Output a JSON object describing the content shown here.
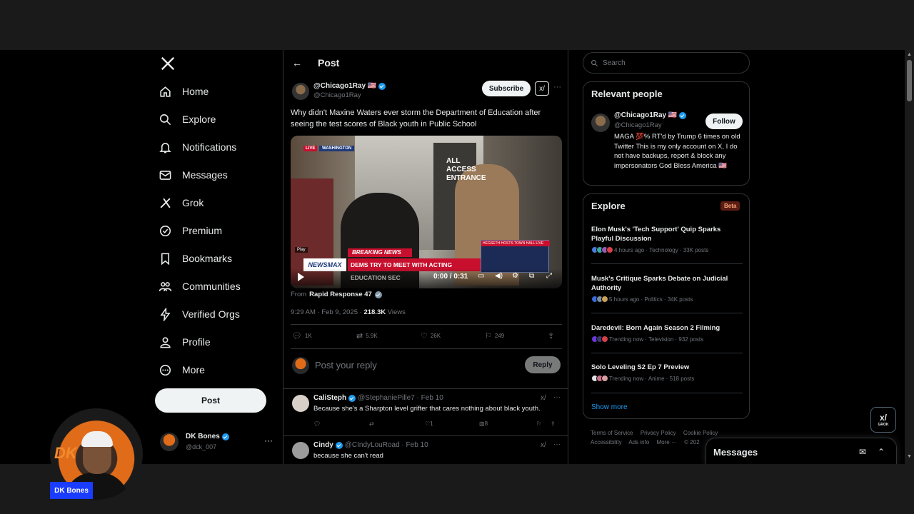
{
  "sidebar": {
    "nav": [
      {
        "label": "Home",
        "icon": "home-icon"
      },
      {
        "label": "Explore",
        "icon": "search-icon"
      },
      {
        "label": "Notifications",
        "icon": "bell-icon"
      },
      {
        "label": "Messages",
        "icon": "mail-icon"
      },
      {
        "label": "Grok",
        "icon": "grok-icon"
      },
      {
        "label": "Premium",
        "icon": "premium-icon"
      },
      {
        "label": "Bookmarks",
        "icon": "bookmark-icon"
      },
      {
        "label": "Communities",
        "icon": "communities-icon"
      },
      {
        "label": "Verified Orgs",
        "icon": "lightning-icon"
      },
      {
        "label": "Profile",
        "icon": "person-icon"
      },
      {
        "label": "More",
        "icon": "more-circle-icon"
      }
    ],
    "post_label": "Post",
    "account": {
      "name": "DK Bones",
      "handle": "@dck_007",
      "more": "···"
    }
  },
  "main": {
    "title": "Post",
    "back": "←",
    "tweet": {
      "name": "@Chicago1Ray 🇺🇸",
      "handle": "@Chicago1Ray",
      "subscribe_label": "Subscribe",
      "grok": "x/",
      "more": "···",
      "text": "Why didn't Maxine Waters ever storm the Department of Education after seeing the test scores of Black youth in Public School",
      "video": {
        "live": "LIVE",
        "location": "WASHINGTON",
        "sign": "ALL ACCESS ENTRANCE",
        "breaking": "BREAKING NEWS",
        "network": "NEWSMAX",
        "headline": "DEMS TRY TO MEET WITH ACTING EDUCATION SEC",
        "inset": "HEGSETH HOSTS TOWN HALL  LIVE",
        "play_label": "Play",
        "time": "0:00 / 0:31"
      },
      "from_prefix": "From",
      "from_account": "Rapid Response 47",
      "time": "9:29 AM · Feb 9, 2025 · ",
      "views_count": "218.3K",
      "views_label": " Views",
      "stats": {
        "replies": "1K",
        "reposts": "5.9K",
        "likes": "26K",
        "bookmarks": "249"
      }
    },
    "reply_placeholder": "Post your reply",
    "reply_label": "Reply",
    "replies": [
      {
        "name": "CaliSteph",
        "handle": "@StephaniePille7 · Feb 10",
        "text": "Because she's a Sharpton level grifter that cares nothing about black youth.",
        "likes": "1",
        "views": "8"
      },
      {
        "name": "Cindy",
        "handle": "@CIndyLouRoad · Feb 10",
        "text": "because she can't read"
      }
    ]
  },
  "right": {
    "search_placeholder": "Search",
    "relevant_title": "Relevant people",
    "person": {
      "name": "@Chicago1Ray 🇺🇸",
      "handle": "@Chicago1Ray",
      "follow_label": "Follow",
      "bio": "MAGA 💯% RT'd by Trump 6 times on old Twitter This is my only account on X, I do not have backups, report & block any impersonators God Bless America 🇺🇸"
    },
    "explore_title": "Explore",
    "beta": "Beta",
    "trends": [
      {
        "title": "Elon Musk's 'Tech Support' Quip Sparks Playful Discussion",
        "meta": "4 hours ago · Technology · 33K posts"
      },
      {
        "title": "Musk's Critique Sparks Debate on Judicial Authority",
        "meta": "5 hours ago · Politics · 34K posts"
      },
      {
        "title": "Daredevil: Born Again Season 2 Filming",
        "meta": "Trending now · Television · 932 posts"
      },
      {
        "title": "Solo Leveling S2 Ep 7 Preview",
        "meta": "Trending now · Anime · 518 posts"
      }
    ],
    "show_more": "Show more",
    "footer": [
      "Terms of Service",
      "Privacy Policy",
      "Cookie Policy",
      "Accessibility",
      "Ads info",
      "More ···",
      "© 202"
    ]
  },
  "grok_float": {
    "label": "x/",
    "sub": "GROK"
  },
  "messages_dock": {
    "title": "Messages"
  },
  "webcam": {
    "label": "DK Bones",
    "logo": "DK"
  }
}
